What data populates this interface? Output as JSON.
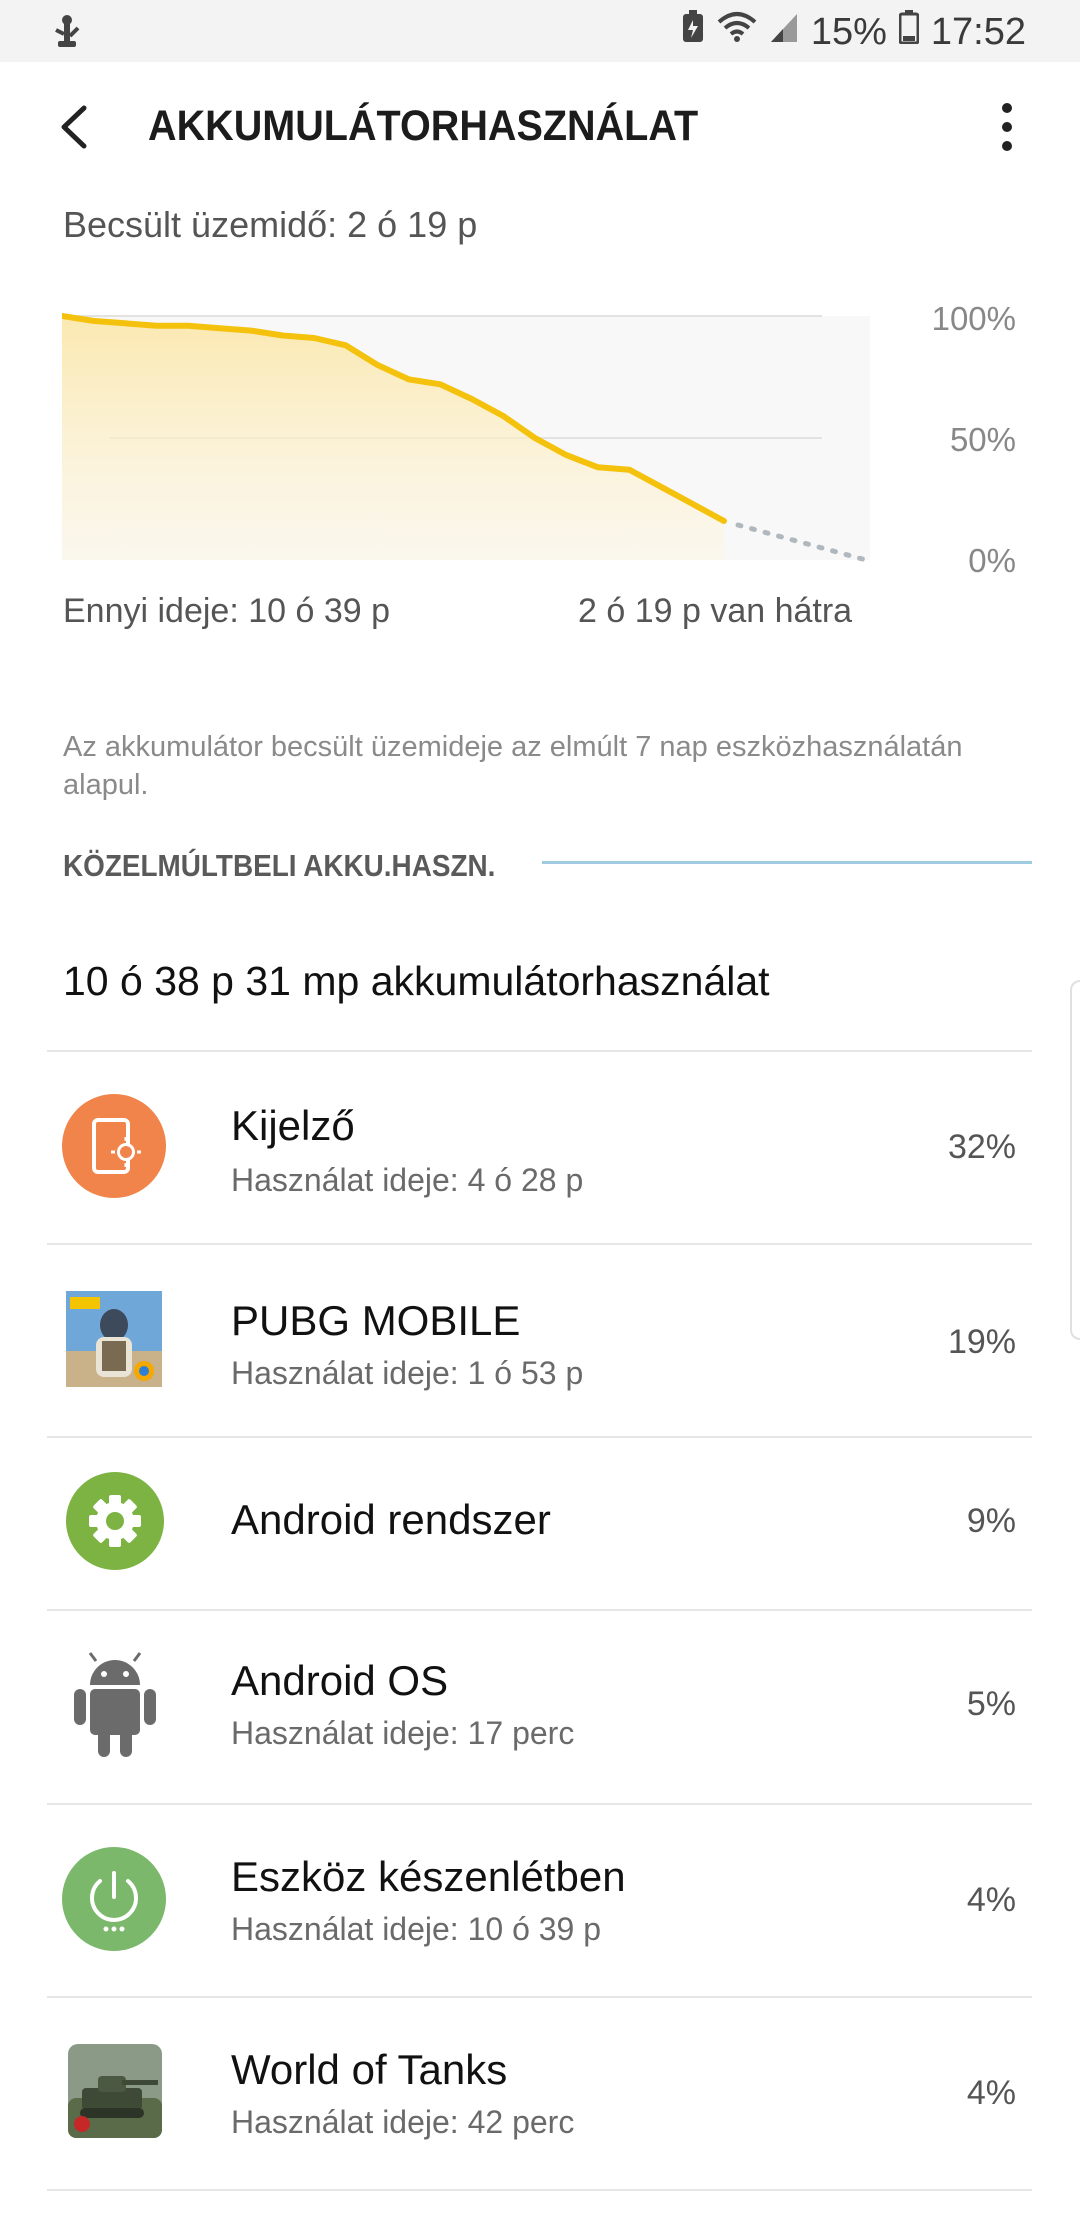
{
  "status_bar": {
    "battery_percent": "15%",
    "time": "17:52"
  },
  "app_bar": {
    "title": "AKKUMULÁTORHASZNÁLAT"
  },
  "estimate": "Becsült üzemidő: 2 ó 19 p",
  "chart_data": {
    "type": "area",
    "y_ticks": [
      "100%",
      "50%",
      "0%"
    ],
    "ylim": [
      0,
      100
    ],
    "x_label_left": "Ennyi ideje: 10 ó 39 p",
    "x_label_right": "2 ó 19 p van hátra",
    "series": [
      {
        "values": [
          100,
          98,
          97,
          96,
          96,
          95,
          94,
          92,
          91,
          88,
          80,
          74,
          72,
          66,
          59,
          50,
          43,
          38,
          37,
          30,
          23,
          16
        ]
      }
    ],
    "projection": [
      16,
      0
    ],
    "colors": {
      "line": "#f4c20d",
      "fill_top": "#fbe7a8",
      "projection": "#b0b8bd",
      "grid": "#e2e2e2",
      "bg": "#f8f8f8"
    },
    "grid": true
  },
  "note": "Az akkumulátor becsült üzemideje az elmúlt 7 nap eszközhasználatán alapul.",
  "section_title": "KÖZELMÚLTBELI AKKU.HASZN.",
  "total_usage": "10 ó 38 p 31 mp akkumulátorhasználat",
  "apps": [
    {
      "name": "Kijelző",
      "sub": "Használat ideje: 4 ó 28 p",
      "pct": "32%",
      "icon": "display-brightness-icon",
      "color": "#f0844a"
    },
    {
      "name": "PUBG MOBILE",
      "sub": "Használat ideje: 1 ó 53 p",
      "pct": "19%",
      "icon": "pubg-app-icon",
      "color": "#3b6fb0"
    },
    {
      "name": "Android rendszer",
      "sub": "",
      "pct": "9%",
      "icon": "gear-icon",
      "color": "#7cb342"
    },
    {
      "name": "Android OS",
      "sub": "Használat ideje: 17 perc",
      "pct": "5%",
      "icon": "android-robot-icon",
      "color": "#6b6b6b"
    },
    {
      "name": "Eszköz készenlétben",
      "sub": "Használat ideje: 10 ó 39 p",
      "pct": "4%",
      "icon": "power-icon",
      "color": "#7cb86c"
    },
    {
      "name": "World of Tanks",
      "sub": "Használat ideje: 42 perc",
      "pct": "4%",
      "icon": "world-of-tanks-app-icon",
      "color": "#5a6b4a"
    }
  ]
}
